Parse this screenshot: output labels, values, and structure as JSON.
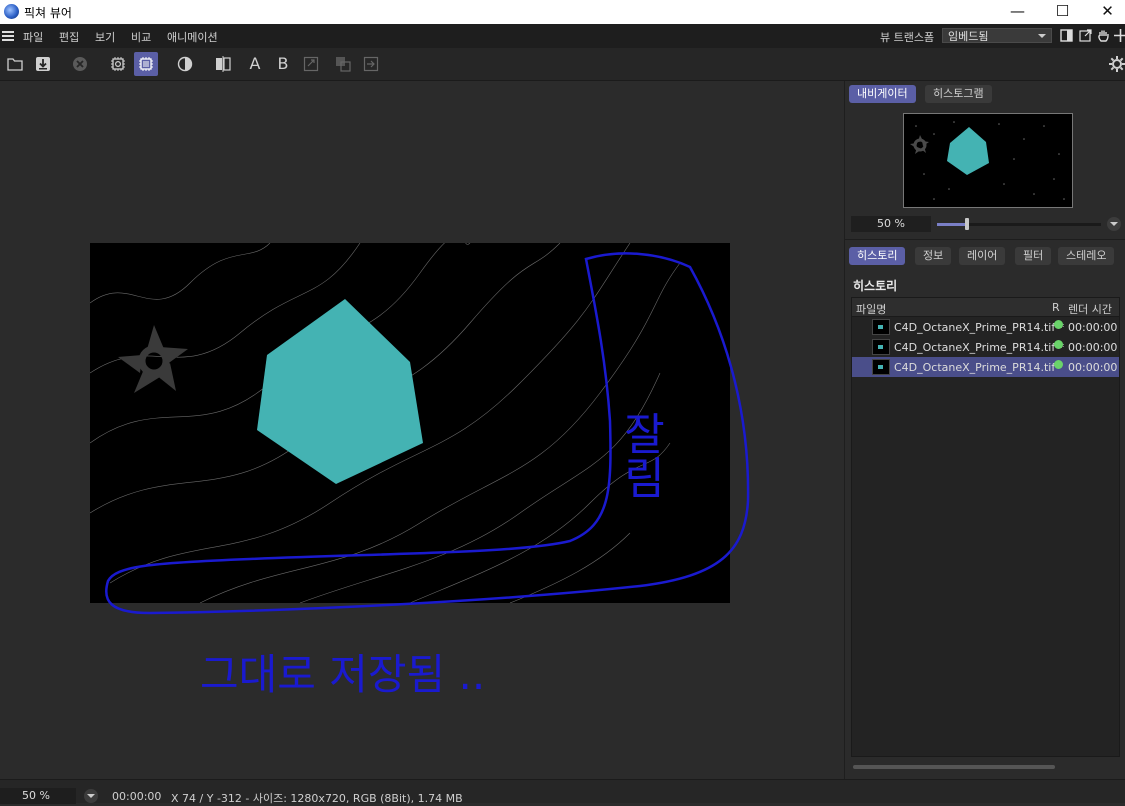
{
  "window": {
    "title": "픽쳐 뷰어",
    "minimize": "—",
    "maximize": "☐",
    "close": "✕"
  },
  "menu": {
    "items": [
      "파일",
      "편집",
      "보기",
      "비교",
      "애니메이션"
    ]
  },
  "view_transform": {
    "label": "뷰 트랜스폼",
    "value": "임베드됨"
  },
  "toolbar": {
    "letter_a": "A",
    "letter_b": "B"
  },
  "navigator": {
    "tabs": [
      "내비게이터",
      "히스토그램"
    ],
    "zoom": "50 %",
    "zoom_level": 0.18
  },
  "info_tabs": [
    "히스토리",
    "정보",
    "레이어",
    "필터",
    "스테레오"
  ],
  "history": {
    "heading": "히스토리",
    "columns": {
      "name": "파일명",
      "r": "R",
      "time": "렌더 시간"
    },
    "rows": [
      {
        "name": "C4D_OctaneX_Prime_PR14.tif *",
        "time": "00:00:00",
        "selected": false
      },
      {
        "name": "C4D_OctaneX_Prime_PR14.tif *",
        "time": "00:00:00",
        "selected": false
      },
      {
        "name": "C4D_OctaneX_Prime_PR14.tif",
        "time": "00:00:00",
        "selected": true
      }
    ]
  },
  "annotations": {
    "side_text": "잘림",
    "bottom_text": "그대로 저장됨 .."
  },
  "status": {
    "zoom": "50 %",
    "time": "00:00:00",
    "info": "X 74 / Y -312 - 사이즈: 1280x720, RGB (8Bit), 1.74 MB"
  },
  "colors": {
    "accent": "#5b5fa6",
    "cyan_shape": "#44b3b3",
    "annotation": "#1a1acf",
    "status_ok": "#6ad36a"
  }
}
